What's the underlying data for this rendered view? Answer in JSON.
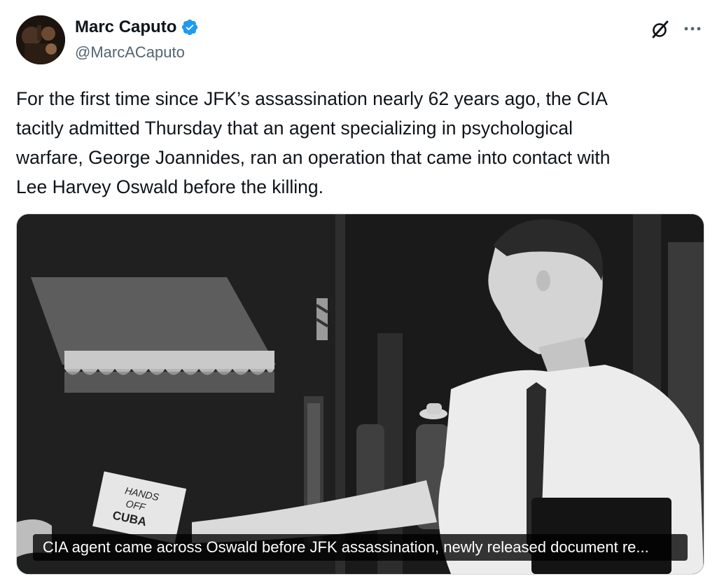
{
  "author": {
    "name": "Marc Caputo",
    "handle": "@MarcACaputo",
    "verified": true,
    "verified_color": "#1d9bf0"
  },
  "header_actions": {
    "grok_icon": "grok-icon",
    "more_icon": "more-options-icon"
  },
  "tweet": {
    "text": "For the first time since JFK’s assassination nearly 62 years ago, the CIA\ntacitly admitted Thursday that an agent specializing in psychological\nwarfare, George Joannides, ran an operation that came into contact with\nLee Harvey Oswald before the killing."
  },
  "media": {
    "sign_text_line1": "HANDS",
    "sign_text_line2": "OFF",
    "sign_text_line3": "CUBA",
    "card_title": "CIA agent came across Oswald before JFK assassination, newly released document re..."
  }
}
